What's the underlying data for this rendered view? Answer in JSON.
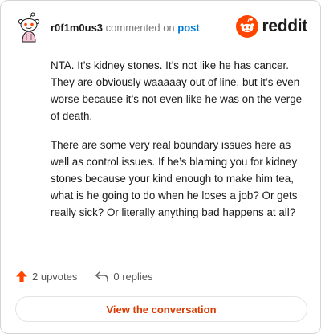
{
  "comment": {
    "username": "r0f1m0us3",
    "action_text": "commented on",
    "post_link_text": "post",
    "paragraphs": [
      "NTA. It’s kidney stones. It’s not like he has cancer. They are obviously waaaaay out of line, but it’s even worse because it’s not even like he was on the verge of death.",
      "There are some very real boundary issues here as well as control issues. If he’s blaming you for kidney stones because your kind enough to make him tea, what is he going to do when he loses a job? Or gets really sick? Or literally anything bad happens at all?"
    ]
  },
  "brand": {
    "wordmark": "reddit",
    "accent_color": "#ff4500",
    "icon": "reddit-alien-icon"
  },
  "actions": {
    "upvotes_label": "2 upvotes",
    "replies_label": "0 replies",
    "upvote_icon": "upvote-arrow-icon",
    "reply_icon": "reply-arrow-icon"
  },
  "cta": {
    "label": "View the conversation"
  },
  "colors": {
    "cta_text": "#d93a00",
    "link": "#0079d3"
  }
}
